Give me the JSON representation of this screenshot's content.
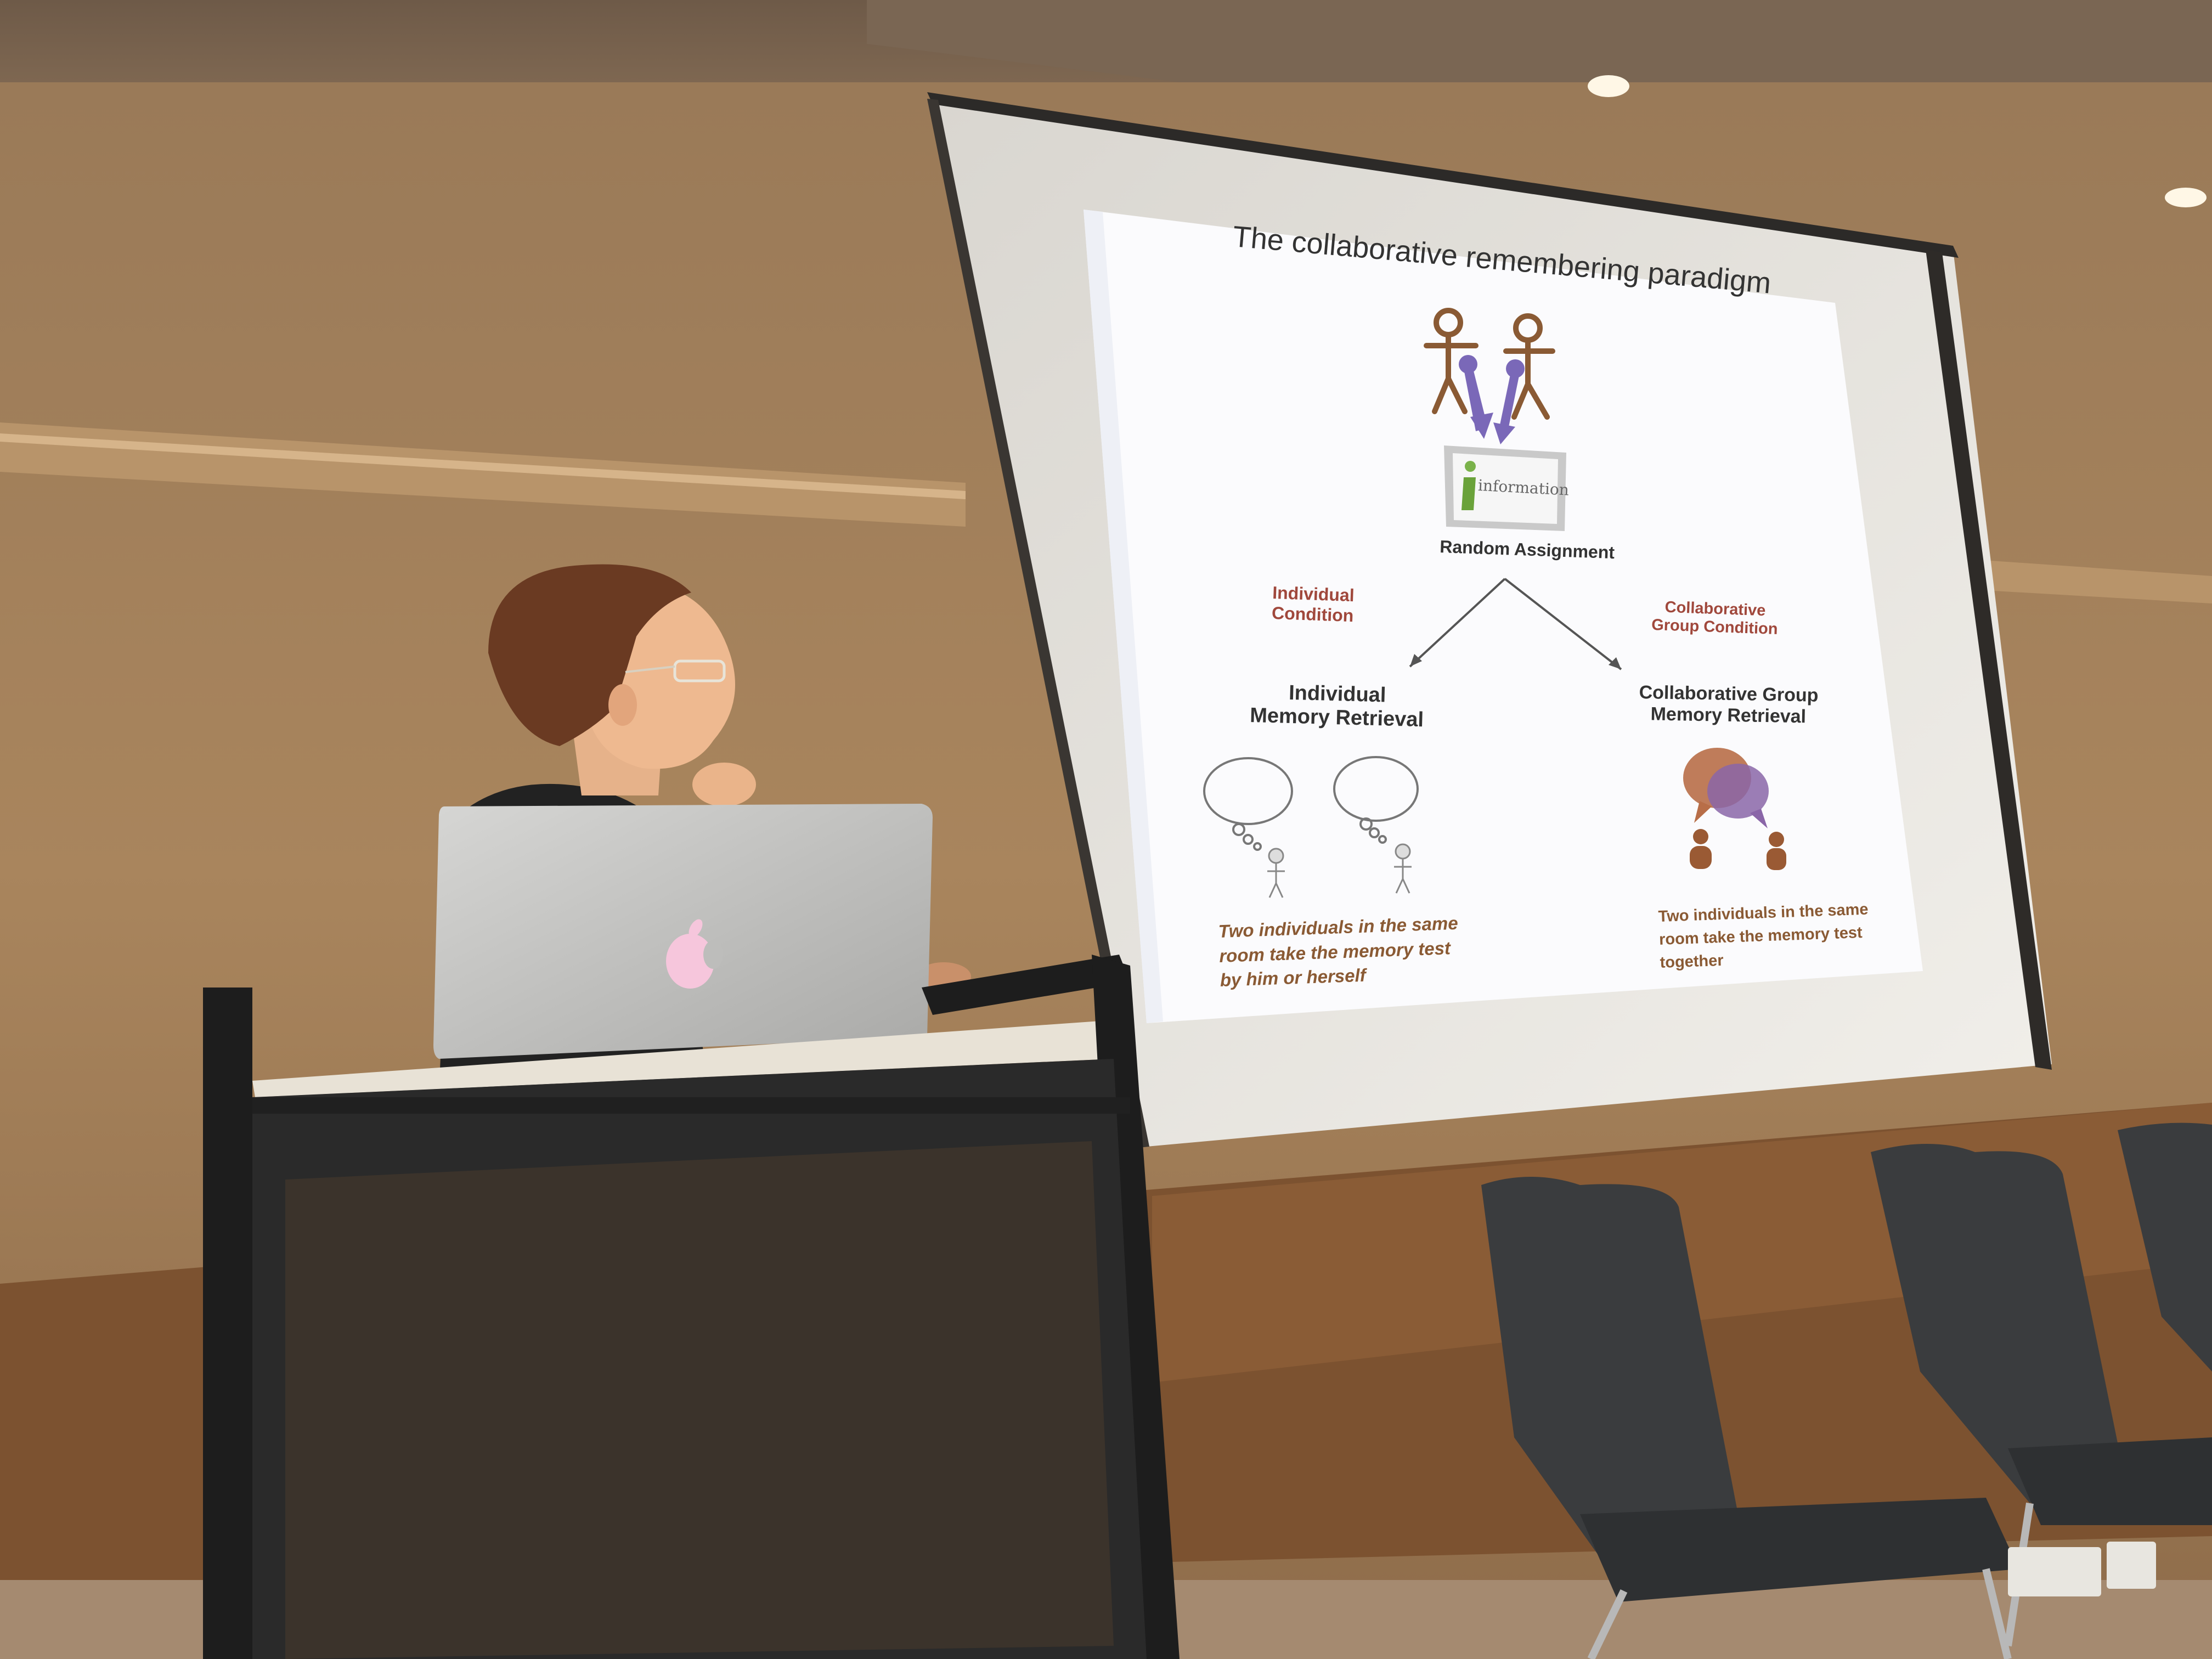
{
  "slide": {
    "title": "The collaborative remembering paradigm",
    "info_sign": "information",
    "random_assignment": "Random Assignment",
    "left_condition_line1": "Individual",
    "left_condition_line2": "Condition",
    "right_condition_line1": "Collaborative",
    "right_condition_line2": "Group Condition",
    "left_retrieval_line1": "Individual",
    "left_retrieval_line2": "Memory Retrieval",
    "right_retrieval_line1": "Collaborative Group",
    "right_retrieval_line2": "Memory Retrieval",
    "left_caption_line1": "Two individuals in the same",
    "left_caption_line2": "room take the memory test",
    "left_caption_line3": "by him or herself",
    "right_caption_line1": "Two individuals in the same",
    "right_caption_line2": "room take the memory test",
    "right_caption_line3": "together"
  },
  "colors": {
    "wall": "#a8825a",
    "screen": "#e9e6df",
    "slide_bg": "#ffffff",
    "accent_red": "#a0483c",
    "stick_brown": "#8a5a34",
    "arrow_purple": "#7a68b8",
    "laptop": "#c8c8c6",
    "apple_logo": "#f6c6dc",
    "podium": "#2a2a2a",
    "chair": "#3a3c3e"
  },
  "icons": [
    "stick-figure-icon",
    "pin-arrow-icon",
    "information-sign-icon",
    "thought-bubble-icon",
    "speech-bubbles-icon",
    "person-icon",
    "apple-logo-icon"
  ]
}
